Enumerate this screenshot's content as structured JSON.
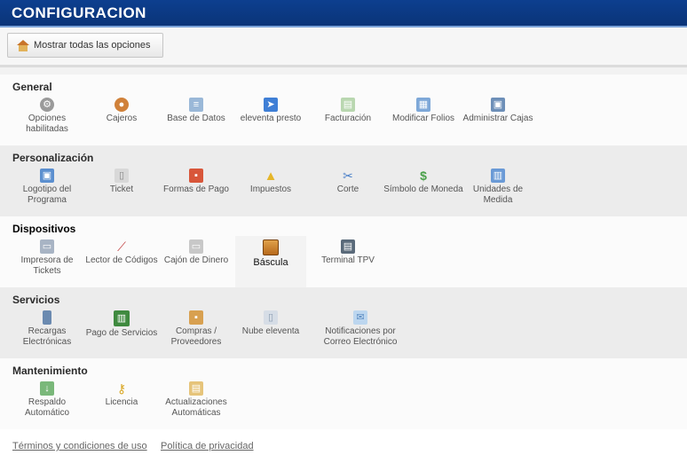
{
  "window": {
    "title": "CONFIGURACION"
  },
  "toolbar": {
    "show_all_label": "Mostrar todas las opciones"
  },
  "sections": {
    "general": {
      "title": "General",
      "items": [
        {
          "label": "Opciones habilitadas",
          "icon": "gear-icon"
        },
        {
          "label": "Cajeros",
          "icon": "user-icon"
        },
        {
          "label": "Base de Datos",
          "icon": "database-icon"
        },
        {
          "label": "eleventa presto",
          "icon": "bird-icon"
        },
        {
          "label": "Facturación",
          "icon": "invoice-icon"
        },
        {
          "label": "Modificar Folios",
          "icon": "calendar-icon"
        },
        {
          "label": "Administrar Cajas",
          "icon": "cash-register-icon"
        }
      ]
    },
    "personalizacion": {
      "title": "Personalización",
      "items": [
        {
          "label": "Logotipo del Programa",
          "icon": "image-icon"
        },
        {
          "label": "Ticket",
          "icon": "ticket-icon"
        },
        {
          "label": "Formas de Pago",
          "icon": "payment-icon"
        },
        {
          "label": "Impuestos",
          "icon": "warning-icon"
        },
        {
          "label": "Corte",
          "icon": "scissors-icon"
        },
        {
          "label": "Símbolo de Moneda",
          "icon": "dollar-icon"
        },
        {
          "label": "Unidades de Medida",
          "icon": "units-icon"
        }
      ]
    },
    "dispositivos": {
      "title": "Dispositivos",
      "items": [
        {
          "label": "Impresora de Tickets",
          "icon": "printer-icon"
        },
        {
          "label": "Lector de Códigos",
          "icon": "barcode-scanner-icon"
        },
        {
          "label": "Cajón de Dinero",
          "icon": "cash-drawer-icon"
        },
        {
          "label": "Báscula",
          "icon": "scale-icon"
        },
        {
          "label": "Terminal TPV",
          "icon": "pos-terminal-icon"
        }
      ]
    },
    "servicios": {
      "title": "Servicios",
      "items": [
        {
          "label": "Recargas Electrónicas",
          "icon": "phone-icon"
        },
        {
          "label": "Pago de Servicios",
          "icon": "bills-icon"
        },
        {
          "label": "Compras / Proveedores",
          "icon": "truck-icon"
        },
        {
          "label": "Nube eleventa",
          "icon": "cloud-icon"
        },
        {
          "label": "Notificaciones por Correo Electrónico",
          "icon": "mail-icon"
        }
      ]
    },
    "mantenimiento": {
      "title": "Mantenimiento",
      "items": [
        {
          "label": "Respaldo Automático",
          "icon": "backup-icon"
        },
        {
          "label": "Licencia",
          "icon": "key-icon"
        },
        {
          "label": "Actualizaciones Automáticas",
          "icon": "update-icon"
        }
      ]
    }
  },
  "footer": {
    "terms": "Términos y condiciones de uso",
    "privacy": "Política de privacidad"
  },
  "colors": {
    "titlebar": "#0d3f8f",
    "accent": "#7aa3d9"
  }
}
